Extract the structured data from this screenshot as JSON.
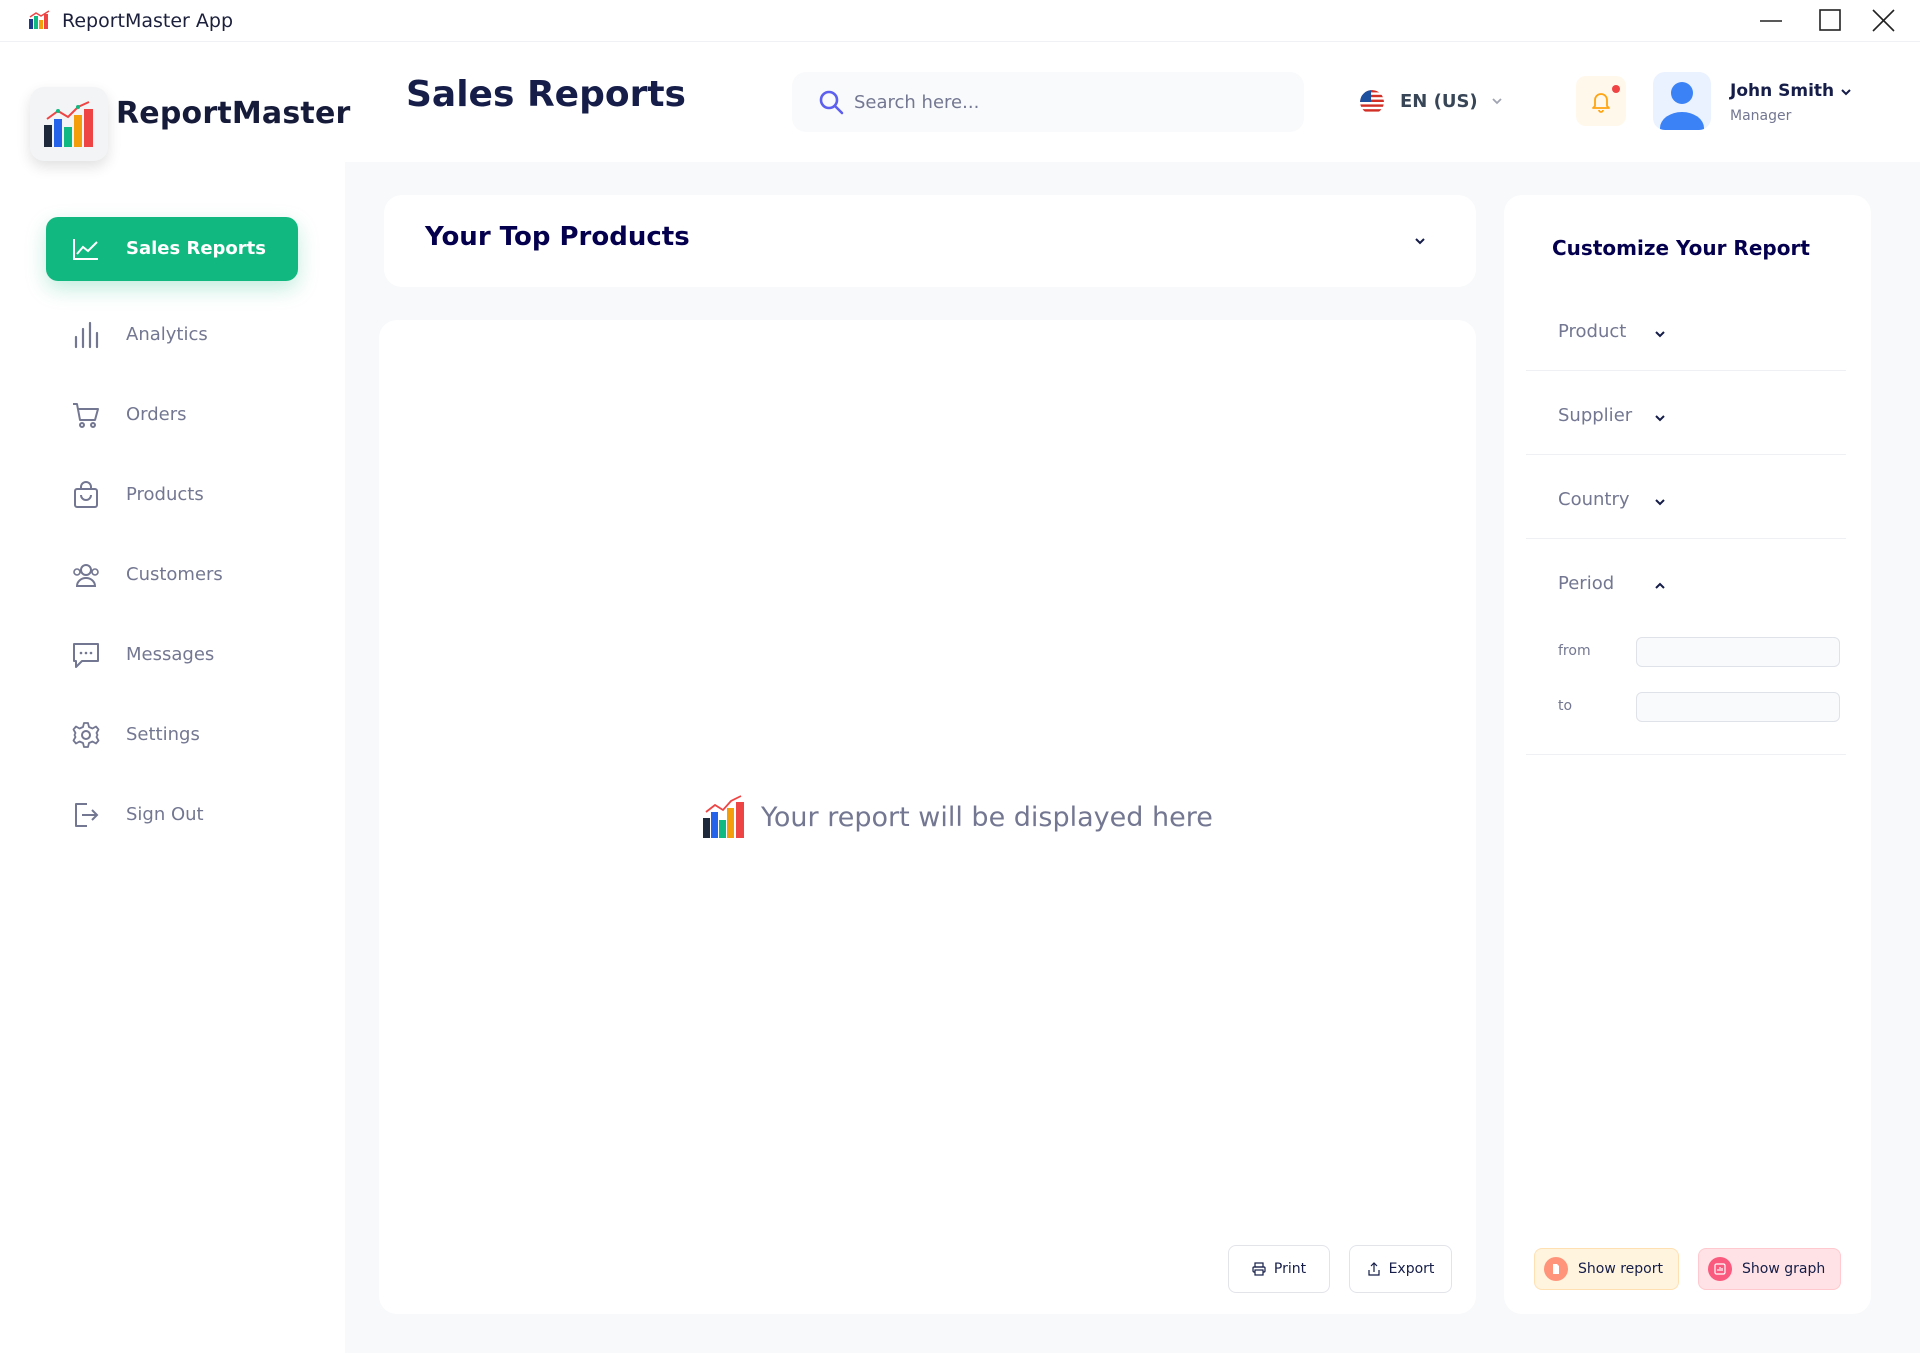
{
  "window": {
    "title": "ReportMaster App"
  },
  "sidebar": {
    "brand": "ReportMaster",
    "active_item": {
      "label": "Sales Reports",
      "icon": "line-chart-icon"
    },
    "items": [
      {
        "label": "Analytics",
        "icon": "bar-chart-icon"
      },
      {
        "label": "Orders",
        "icon": "cart-icon"
      },
      {
        "label": "Products",
        "icon": "shopping-bag-icon"
      },
      {
        "label": "Customers",
        "icon": "users-icon"
      },
      {
        "label": "Messages",
        "icon": "message-icon"
      },
      {
        "label": "Settings",
        "icon": "gear-icon"
      },
      {
        "label": "Sign Out",
        "icon": "sign-out-icon"
      }
    ]
  },
  "header": {
    "title": "Sales Reports",
    "search_placeholder": "Search here...",
    "language": "EN (US)",
    "user": {
      "name": "John Smith",
      "role": "Manager"
    }
  },
  "top_products": {
    "title": "Your Top Products"
  },
  "report": {
    "placeholder": "Your report will be displayed here",
    "print_label": "Print",
    "export_label": "Export"
  },
  "customize": {
    "title": "Customize Your Report",
    "filters": [
      {
        "label": "Product",
        "expanded": false
      },
      {
        "label": "Supplier",
        "expanded": false
      },
      {
        "label": "Country",
        "expanded": false
      },
      {
        "label": "Period",
        "expanded": true
      }
    ],
    "period": {
      "from_label": "from",
      "to_label": "to",
      "from_value": "",
      "to_value": ""
    },
    "show_report_label": "Show report",
    "show_graph_label": "Show graph"
  },
  "colors": {
    "accent": "#11b981",
    "title": "#151d48",
    "muted": "#737791",
    "notification": "#f04444"
  }
}
